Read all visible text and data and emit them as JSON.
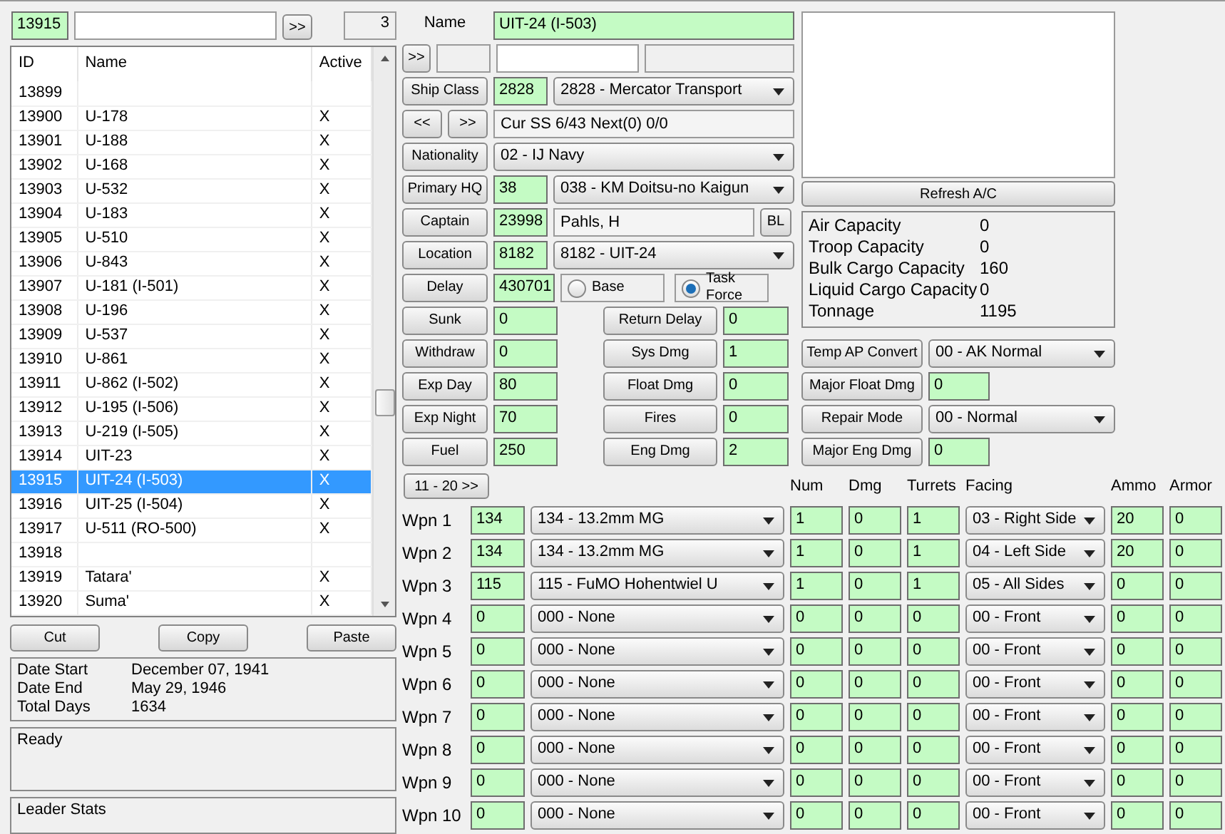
{
  "finder": {
    "id": "13915",
    "go_button": ">>",
    "count": "3"
  },
  "list": {
    "columns": [
      "ID",
      "Name",
      "Active"
    ],
    "rows": [
      {
        "id": "13899",
        "selected": false
      },
      {
        "id": "13900",
        "name": "U-178",
        "active": "X",
        "selected": false
      },
      {
        "id": "13901",
        "name": "U-188",
        "active": "X",
        "selected": false
      },
      {
        "id": "13902",
        "name": "U-168",
        "active": "X",
        "selected": false
      },
      {
        "id": "13903",
        "name": "U-532",
        "active": "X",
        "selected": false
      },
      {
        "id": "13904",
        "name": "U-183",
        "active": "X",
        "selected": false
      },
      {
        "id": "13905",
        "name": "U-510",
        "active": "X",
        "selected": false
      },
      {
        "id": "13906",
        "name": "U-843",
        "active": "X",
        "selected": false
      },
      {
        "id": "13907",
        "name": "U-181 (I-501)",
        "active": "X",
        "selected": false
      },
      {
        "id": "13908",
        "name": "U-196",
        "active": "X",
        "selected": false
      },
      {
        "id": "13909",
        "name": "U-537",
        "active": "X",
        "selected": false
      },
      {
        "id": "13910",
        "name": "U-861",
        "active": "X",
        "selected": false
      },
      {
        "id": "13911",
        "name": "U-862 (I-502)",
        "active": "X",
        "selected": false
      },
      {
        "id": "13912",
        "name": "U-195 (I-506)",
        "active": "X",
        "selected": false
      },
      {
        "id": "13913",
        "name": "U-219 (I-505)",
        "active": "X",
        "selected": false
      },
      {
        "id": "13914",
        "name": "UIT-23",
        "active": "X",
        "selected": false
      },
      {
        "id": "13915",
        "name": "UIT-24 (I-503)",
        "active": "X",
        "selected": true
      },
      {
        "id": "13916",
        "name": "UIT-25 (I-504)",
        "active": "X",
        "selected": false
      },
      {
        "id": "13917",
        "name": "U-511 (RO-500)",
        "active": "X",
        "selected": false
      },
      {
        "id": "13918",
        "selected": false
      },
      {
        "id": "13919",
        "name": "Tatara'",
        "active": "X",
        "selected": false
      },
      {
        "id": "13920",
        "name": "Suma'",
        "active": "X",
        "selected": false
      }
    ]
  },
  "edit_buttons": [
    "Cut",
    "Copy",
    "Paste"
  ],
  "dates": [
    {
      "label": "Date Start",
      "value": "December 07, 1941"
    },
    {
      "label": "Date End",
      "value": "May 29, 1946"
    },
    {
      "label": "Total Days",
      "value": "1634"
    }
  ],
  "status": "Ready",
  "leader_panel": "Leader Stats",
  "form": [
    {
      "kind": "name",
      "label": "Name",
      "value": "UIT-24 (I-503)"
    },
    {
      "kind": "blank",
      "button": ">>"
    },
    {
      "kind": "pick",
      "button": "Ship Class",
      "code": "2828",
      "option": "2828 - Mercator Transport"
    },
    {
      "kind": "nav",
      "buttons": [
        "<<",
        ">>"
      ],
      "value": "Cur SS 6/43 Next(0) 0/0"
    },
    {
      "kind": "choose",
      "button": "Nationality",
      "option": "02 - IJ Navy"
    },
    {
      "kind": "pick",
      "button": "Primary HQ",
      "code": "38",
      "option": "038 - KM Doitsu-no Kaigun"
    },
    {
      "kind": "captain",
      "button": "Captain",
      "code": "23998",
      "value": "Pahls, H",
      "extra": "BL"
    },
    {
      "kind": "pick",
      "button": "Location",
      "code": "8182",
      "option": "8182 - UIT-24"
    },
    {
      "kind": "delay",
      "button": "Delay",
      "code": "430701",
      "options": [
        {
          "label": "Base",
          "selected": false
        },
        {
          "label": "Task Force",
          "selected": true
        }
      ]
    },
    {
      "kind": "pair",
      "button": "Sunk",
      "code": "0",
      "button2": "Return Delay",
      "code2": "0"
    },
    {
      "kind": "pair",
      "button": "Withdraw",
      "code": "0",
      "button2": "Sys Dmg",
      "code2": "1"
    },
    {
      "kind": "pair",
      "button": "Exp Day",
      "code": "80",
      "button2": "Float Dmg",
      "code2": "0"
    },
    {
      "kind": "pair",
      "button": "Exp Night",
      "code": "70",
      "button2": "Fires",
      "code2": "0"
    },
    {
      "kind": "pair",
      "button": "Fuel",
      "code": "250",
      "button2": "Eng Dmg",
      "code2": "2"
    }
  ],
  "refresh_button": "Refresh A/C",
  "capacity": [
    {
      "label": "Air Capacity",
      "value": "0"
    },
    {
      "label": "Troop Capacity",
      "value": "0"
    },
    {
      "label": "Bulk Cargo Capacity",
      "value": "160"
    },
    {
      "label": "Liquid Cargo Capacity",
      "value": "0"
    },
    {
      "label": "Tonnage",
      "value": "1195"
    }
  ],
  "controls": [
    {
      "kind": "select",
      "button": "Temp AP Convert",
      "option": "00 - AK Normal"
    },
    {
      "kind": "field",
      "button": "Major Float Dmg",
      "value": "0"
    },
    {
      "kind": "select",
      "button": "Repair Mode",
      "option": "00 - Normal"
    },
    {
      "kind": "field",
      "button": "Major Eng Dmg",
      "value": "0"
    }
  ],
  "weapons": {
    "page_button": "11 - 20 >>",
    "columns": [
      "Num",
      "Dmg",
      "Turrets",
      "Facing",
      "Ammo",
      "Armor"
    ],
    "rows": [
      {
        "label": "Wpn 1",
        "code": "134",
        "weapon": "134 - 13.2mm MG",
        "num": "1",
        "dmg": "0",
        "turrets": "1",
        "facing": "03 - Right Side",
        "ammo": "20",
        "armor": "0"
      },
      {
        "label": "Wpn 2",
        "code": "134",
        "weapon": "134 - 13.2mm MG",
        "num": "1",
        "dmg": "0",
        "turrets": "1",
        "facing": "04 - Left Side",
        "ammo": "20",
        "armor": "0"
      },
      {
        "label": "Wpn 3",
        "code": "115",
        "weapon": "115 - FuMO Hohentwiel U",
        "num": "1",
        "dmg": "0",
        "turrets": "1",
        "facing": "05 - All Sides",
        "ammo": "0",
        "armor": "0"
      },
      {
        "label": "Wpn 4",
        "code": "0",
        "weapon": "000 - None",
        "num": "0",
        "dmg": "0",
        "turrets": "0",
        "facing": "00 - Front",
        "ammo": "0",
        "armor": "0"
      },
      {
        "label": "Wpn 5",
        "code": "0",
        "weapon": "000 - None",
        "num": "0",
        "dmg": "0",
        "turrets": "0",
        "facing": "00 - Front",
        "ammo": "0",
        "armor": "0"
      },
      {
        "label": "Wpn 6",
        "code": "0",
        "weapon": "000 - None",
        "num": "0",
        "dmg": "0",
        "turrets": "0",
        "facing": "00 - Front",
        "ammo": "0",
        "armor": "0"
      },
      {
        "label": "Wpn 7",
        "code": "0",
        "weapon": "000 - None",
        "num": "0",
        "dmg": "0",
        "turrets": "0",
        "facing": "00 - Front",
        "ammo": "0",
        "armor": "0"
      },
      {
        "label": "Wpn 8",
        "code": "0",
        "weapon": "000 - None",
        "num": "0",
        "dmg": "0",
        "turrets": "0",
        "facing": "00 - Front",
        "ammo": "0",
        "armor": "0"
      },
      {
        "label": "Wpn 9",
        "code": "0",
        "weapon": "000 - None",
        "num": "0",
        "dmg": "0",
        "turrets": "0",
        "facing": "00 - Front",
        "ammo": "0",
        "armor": "0"
      },
      {
        "label": "Wpn 10",
        "code": "0",
        "weapon": "000 - None",
        "num": "0",
        "dmg": "0",
        "turrets": "0",
        "facing": "00 - Front",
        "ammo": "0",
        "armor": "0"
      }
    ]
  }
}
